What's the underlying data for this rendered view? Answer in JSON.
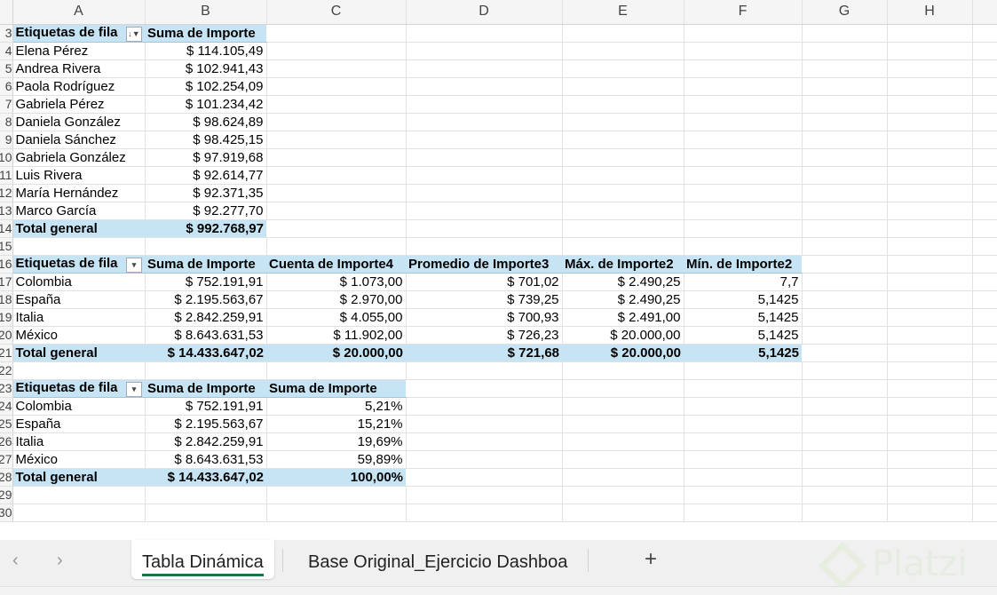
{
  "columns": [
    "A",
    "B",
    "C",
    "D",
    "E",
    "F",
    "G",
    "H",
    ""
  ],
  "rows": [
    {
      "num": "3",
      "type": "head",
      "cells": [
        "Etiquetas de fila",
        "Suma de Importe"
      ],
      "filter": "sorted-filter"
    },
    {
      "num": "4",
      "type": "data",
      "cells": [
        "Elena Pérez",
        "$ 114.105,49"
      ]
    },
    {
      "num": "5",
      "type": "data",
      "cells": [
        "Andrea Rivera",
        "$ 102.941,43"
      ]
    },
    {
      "num": "6",
      "type": "data",
      "cells": [
        "Paola Rodríguez",
        "$ 102.254,09"
      ]
    },
    {
      "num": "7",
      "type": "data",
      "cells": [
        "Gabriela Pérez",
        "$ 101.234,42"
      ]
    },
    {
      "num": "8",
      "type": "data",
      "cells": [
        "Daniela González",
        "$ 98.624,89"
      ]
    },
    {
      "num": "9",
      "type": "data",
      "cells": [
        "Daniela Sánchez",
        "$ 98.425,15"
      ]
    },
    {
      "num": "10",
      "type": "data",
      "cells": [
        "Gabriela González",
        "$ 97.919,68"
      ]
    },
    {
      "num": "11",
      "type": "data",
      "cells": [
        "Luis Rivera",
        "$ 92.614,77"
      ]
    },
    {
      "num": "12",
      "type": "data",
      "cells": [
        "María Hernández",
        "$ 92.371,35"
      ]
    },
    {
      "num": "13",
      "type": "data",
      "cells": [
        "Marco García",
        "$ 92.277,70"
      ]
    },
    {
      "num": "14",
      "type": "total",
      "cells": [
        "Total general",
        "$ 992.768,97"
      ]
    },
    {
      "num": "15",
      "type": "empty",
      "cells": []
    },
    {
      "num": "16",
      "type": "head",
      "cells": [
        "Etiquetas de fila",
        "Suma de Importe",
        "Cuenta de Importe4",
        "Promedio de Importe3",
        "Máx. de Importe2",
        "Mín. de Importe2"
      ],
      "filter": "dropdown"
    },
    {
      "num": "17",
      "type": "data",
      "cells": [
        "Colombia",
        "$ 752.191,91",
        "$ 1.073,00",
        "$ 701,02",
        "$ 2.490,25",
        "7,7"
      ]
    },
    {
      "num": "18",
      "type": "data",
      "cells": [
        "España",
        "$ 2.195.563,67",
        "$ 2.970,00",
        "$ 739,25",
        "$ 2.490,25",
        "5,1425"
      ]
    },
    {
      "num": "19",
      "type": "data",
      "cells": [
        "Italia",
        "$ 2.842.259,91",
        "$ 4.055,00",
        "$ 700,93",
        "$ 2.491,00",
        "5,1425"
      ]
    },
    {
      "num": "20",
      "type": "data",
      "cells": [
        "México",
        "$ 8.643.631,53",
        "$ 11.902,00",
        "$ 726,23",
        "$ 20.000,00",
        "5,1425"
      ]
    },
    {
      "num": "21",
      "type": "total",
      "cells": [
        "Total general",
        "$ 14.433.647,02",
        "$ 20.000,00",
        "$ 721,68",
        "$ 20.000,00",
        "5,1425"
      ]
    },
    {
      "num": "22",
      "type": "empty",
      "cells": []
    },
    {
      "num": "23",
      "type": "head",
      "cells": [
        "Etiquetas de fila",
        "Suma de Importe",
        "Suma de Importe"
      ],
      "filter": "dropdown"
    },
    {
      "num": "24",
      "type": "data",
      "cells": [
        "Colombia",
        "$ 752.191,91",
        "5,21%"
      ]
    },
    {
      "num": "25",
      "type": "data",
      "cells": [
        "España",
        "$ 2.195.563,67",
        "15,21%"
      ]
    },
    {
      "num": "26",
      "type": "data",
      "cells": [
        "Italia",
        "$ 2.842.259,91",
        "19,69%"
      ]
    },
    {
      "num": "27",
      "type": "data",
      "cells": [
        "México",
        "$ 8.643.631,53",
        "59,89%"
      ]
    },
    {
      "num": "28",
      "type": "total",
      "cells": [
        "Total general",
        "$ 14.433.647,02",
        "100,00%"
      ]
    },
    {
      "num": "29",
      "type": "empty",
      "cells": []
    },
    {
      "num": "30",
      "type": "empty",
      "cells": []
    }
  ],
  "tabs": {
    "active": "Tabla Dinámica",
    "other": "Base Original_Ejercicio Dashboa",
    "add": "+",
    "prev": "‹",
    "next": "›"
  },
  "watermark": "Platzi"
}
